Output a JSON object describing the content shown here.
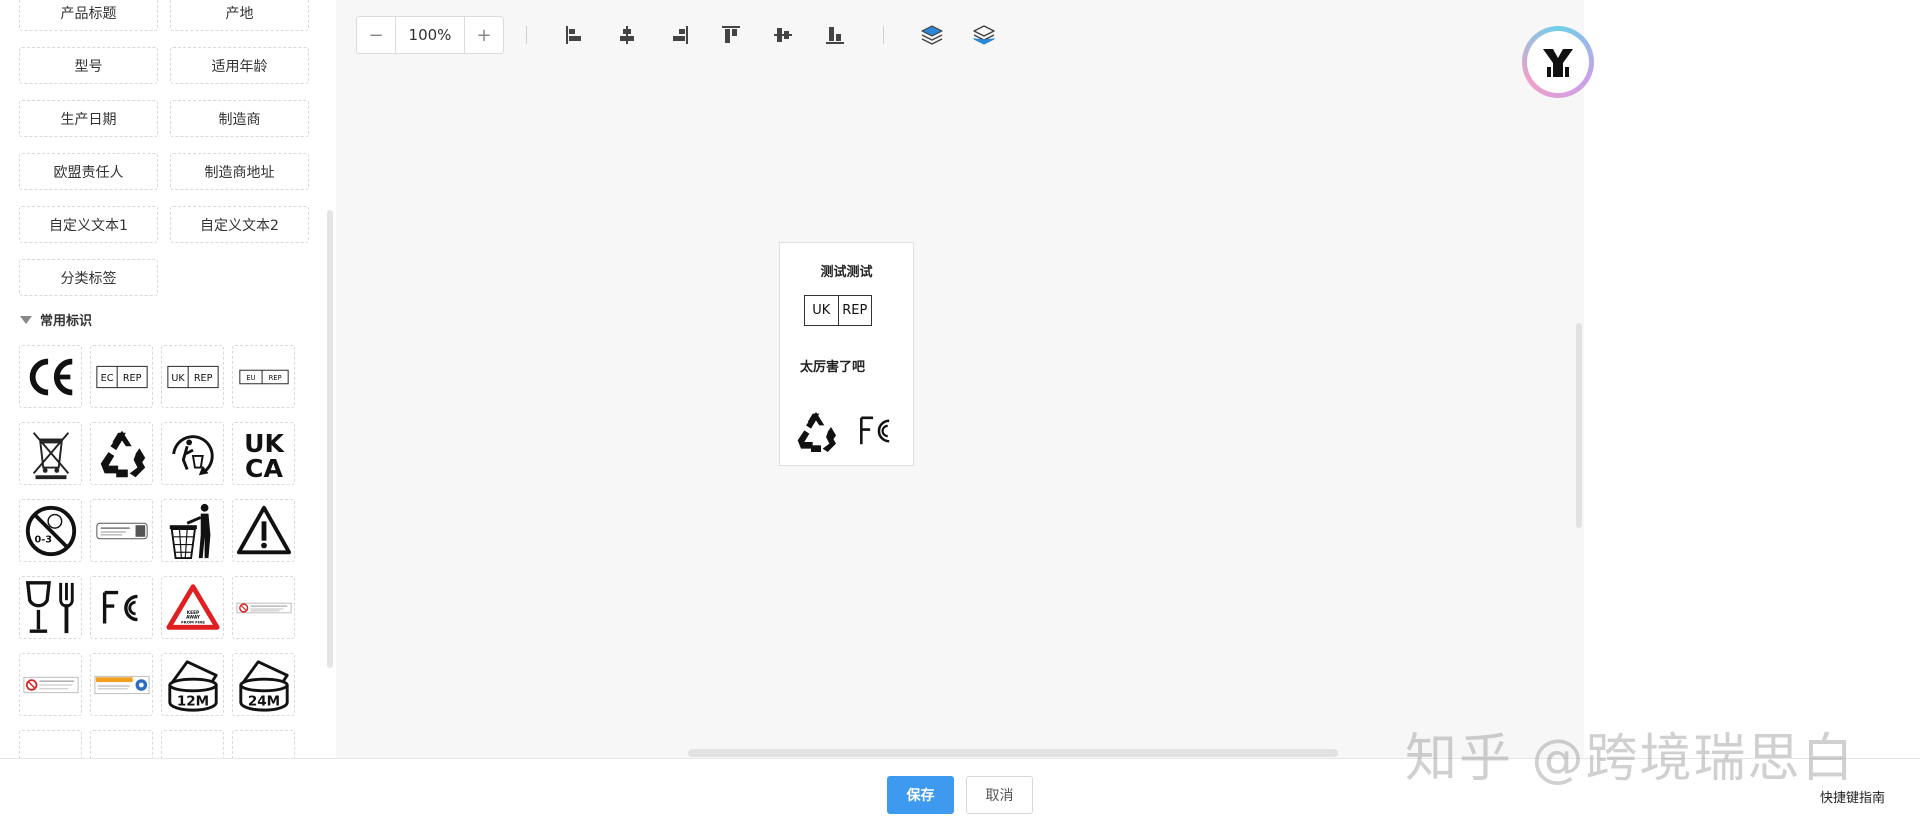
{
  "sidebar": {
    "fields": [
      "产品标题",
      "产地",
      "型号",
      "适用年龄",
      "生产日期",
      "制造商",
      "欧盟责任人",
      "制造商地址",
      "自定义文本1",
      "自定义文本2",
      "分类标签"
    ],
    "section_title": "常用标识",
    "icons": [
      {
        "name": "ce-mark-icon",
        "text": "CE"
      },
      {
        "name": "ec-rep-icon",
        "left": "EC",
        "right": "REP"
      },
      {
        "name": "uk-rep-icon",
        "left": "UK",
        "right": "REP"
      },
      {
        "name": "eu-rep-icon",
        "left": "EU",
        "right": "REP"
      },
      {
        "name": "weee-bin-icon"
      },
      {
        "name": "recycle-icon"
      },
      {
        "name": "tidyman-recycle-icon"
      },
      {
        "name": "ukca-mark-icon",
        "line1": "UK",
        "line2": "CA"
      },
      {
        "name": "age-0-3-warning-icon",
        "text": "0-3"
      },
      {
        "name": "warning-label-icon"
      },
      {
        "name": "tidyman-bin-icon"
      },
      {
        "name": "warning-triangle-icon"
      },
      {
        "name": "food-safe-icon"
      },
      {
        "name": "fcc-mark-icon",
        "text": "FC"
      },
      {
        "name": "keep-away-fire-icon",
        "text": "KEEP AWAY FROM FIRE"
      },
      {
        "name": "no-small-parts-label-icon"
      },
      {
        "name": "warning-strip-icon"
      },
      {
        "name": "caution-strip-icon"
      },
      {
        "name": "pao-12m-icon",
        "text": "12M"
      },
      {
        "name": "pao-24m-icon",
        "text": "24M"
      }
    ]
  },
  "toolbar": {
    "zoom_minus": "−",
    "zoom_value": "100%",
    "zoom_plus": "+"
  },
  "label": {
    "title": "测试测试",
    "rep_left": "UK",
    "rep_right": "REP",
    "text": "太厉害了吧",
    "fc_text": "FC"
  },
  "footer": {
    "save": "保存",
    "cancel": "取消",
    "shortcut": "快捷键指南"
  },
  "watermark": "知乎 @跨境瑞思白",
  "colors": {
    "primary": "#3d9aee",
    "layer_icon": "#2b88d8",
    "keep_away_red": "#e02020"
  }
}
